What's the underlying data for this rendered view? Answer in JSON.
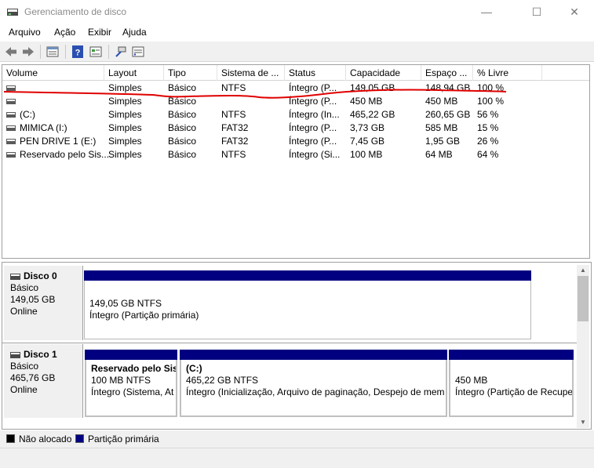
{
  "window": {
    "title": "Gerenciamento de disco",
    "minimize": "—",
    "maximize": "☐",
    "close": "✕"
  },
  "menu": [
    "Arquivo",
    "Ação",
    "Exibir",
    "Ajuda"
  ],
  "toolbar": {
    "icons": [
      "back-icon",
      "forward-icon",
      "disk-list-icon",
      "help-icon",
      "properties-icon",
      "connect-icon",
      "settings-icon"
    ]
  },
  "volume_list": {
    "columns": [
      "Volume",
      "Layout",
      "Tipo",
      "Sistema de ...",
      "Status",
      "Capacidade",
      "Espaço ...",
      "% Livre"
    ],
    "rows": [
      {
        "volume": "",
        "layout": "Simples",
        "tipo": "Básico",
        "sistema": "NTFS",
        "status": "Íntegro (P...",
        "capacidade": "149,05 GB",
        "espaco": "148,94 GB",
        "livre": "100 %"
      },
      {
        "volume": "",
        "layout": "Simples",
        "tipo": "Básico",
        "sistema": "",
        "status": "Íntegro (P...",
        "capacidade": "450 MB",
        "espaco": "450 MB",
        "livre": "100 %"
      },
      {
        "volume": "(C:)",
        "layout": "Simples",
        "tipo": "Básico",
        "sistema": "NTFS",
        "status": "Íntegro (In...",
        "capacidade": "465,22 GB",
        "espaco": "260,65 GB",
        "livre": "56 %"
      },
      {
        "volume": "MIMICA (I:)",
        "layout": "Simples",
        "tipo": "Básico",
        "sistema": "FAT32",
        "status": "Íntegro (P...",
        "capacidade": "3,73 GB",
        "espaco": "585 MB",
        "livre": "15 %"
      },
      {
        "volume": "PEN DRIVE 1 (E:)",
        "layout": "Simples",
        "tipo": "Básico",
        "sistema": "FAT32",
        "status": "Íntegro (P...",
        "capacidade": "7,45 GB",
        "espaco": "1,95 GB",
        "livre": "26 %"
      },
      {
        "volume": "Reservado pelo Sis...",
        "layout": "Simples",
        "tipo": "Básico",
        "sistema": "NTFS",
        "status": "Íntegro (Si...",
        "capacidade": "100 MB",
        "espaco": "64 MB",
        "livre": "64 %"
      }
    ]
  },
  "disks": [
    {
      "name": "Disco 0",
      "type": "Básico",
      "size": "149,05 GB",
      "state": "Online",
      "partitions": [
        {
          "title": "",
          "size": "149,05 GB NTFS",
          "status": "Íntegro (Partição primária)"
        }
      ]
    },
    {
      "name": "Disco 1",
      "type": "Básico",
      "size": "465,76 GB",
      "state": "Online",
      "partitions": [
        {
          "title": "Reservado pelo Sis",
          "size": "100 MB NTFS",
          "status": "Íntegro (Sistema, At"
        },
        {
          "title": "(C:)",
          "size": "465,22 GB NTFS",
          "status": "Íntegro (Inicialização, Arquivo de paginação, Despejo de mem"
        },
        {
          "title": "",
          "size": "450 MB",
          "status": "Íntegro (Partição de Recupe"
        }
      ]
    }
  ],
  "legend": [
    {
      "label": "Não alocado",
      "color": "#000000"
    },
    {
      "label": "Partição primária",
      "color": "#000080"
    }
  ],
  "colors": {
    "partition_bar": "#000080",
    "annotation": "#e00000"
  }
}
